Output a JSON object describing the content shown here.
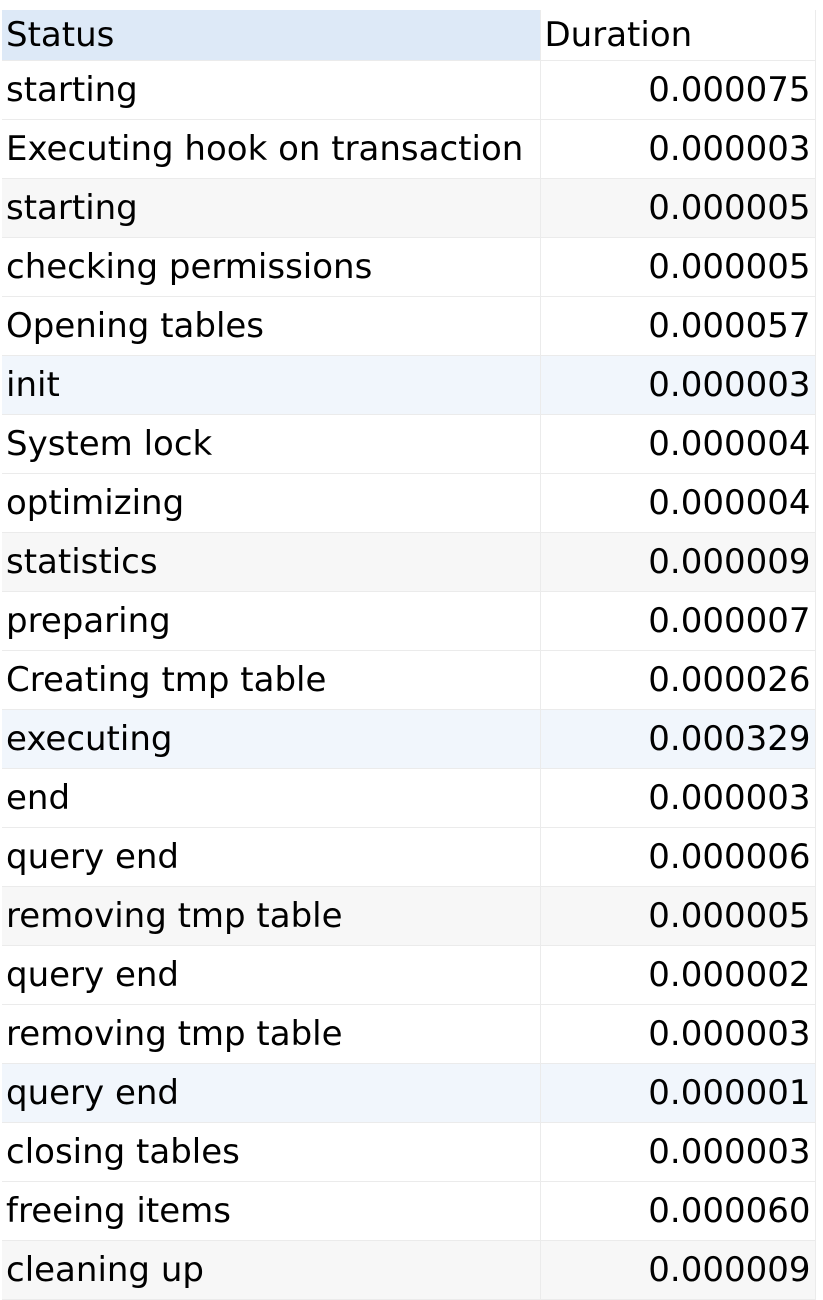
{
  "columns": {
    "status": "Status",
    "duration": "Duration"
  },
  "rows": [
    {
      "status": "starting",
      "duration": "0.000075"
    },
    {
      "status": "Executing hook on transaction",
      "duration": "0.000003"
    },
    {
      "status": "starting",
      "duration": "0.000005"
    },
    {
      "status": "checking permissions",
      "duration": "0.000005"
    },
    {
      "status": "Opening tables",
      "duration": "0.000057"
    },
    {
      "status": "init",
      "duration": "0.000003"
    },
    {
      "status": "System lock",
      "duration": "0.000004"
    },
    {
      "status": "optimizing",
      "duration": "0.000004"
    },
    {
      "status": "statistics",
      "duration": "0.000009"
    },
    {
      "status": "preparing",
      "duration": "0.000007"
    },
    {
      "status": "Creating tmp table",
      "duration": "0.000026"
    },
    {
      "status": "executing",
      "duration": "0.000329"
    },
    {
      "status": "end",
      "duration": "0.000003"
    },
    {
      "status": "query end",
      "duration": "0.000006"
    },
    {
      "status": "removing tmp table",
      "duration": "0.000005"
    },
    {
      "status": "query end",
      "duration": "0.000002"
    },
    {
      "status": "removing tmp table",
      "duration": "0.000003"
    },
    {
      "status": "query end",
      "duration": "0.000001"
    },
    {
      "status": "closing tables",
      "duration": "0.000003"
    },
    {
      "status": "freeing items",
      "duration": "0.000060"
    },
    {
      "status": "cleaning up",
      "duration": "0.000009"
    }
  ]
}
